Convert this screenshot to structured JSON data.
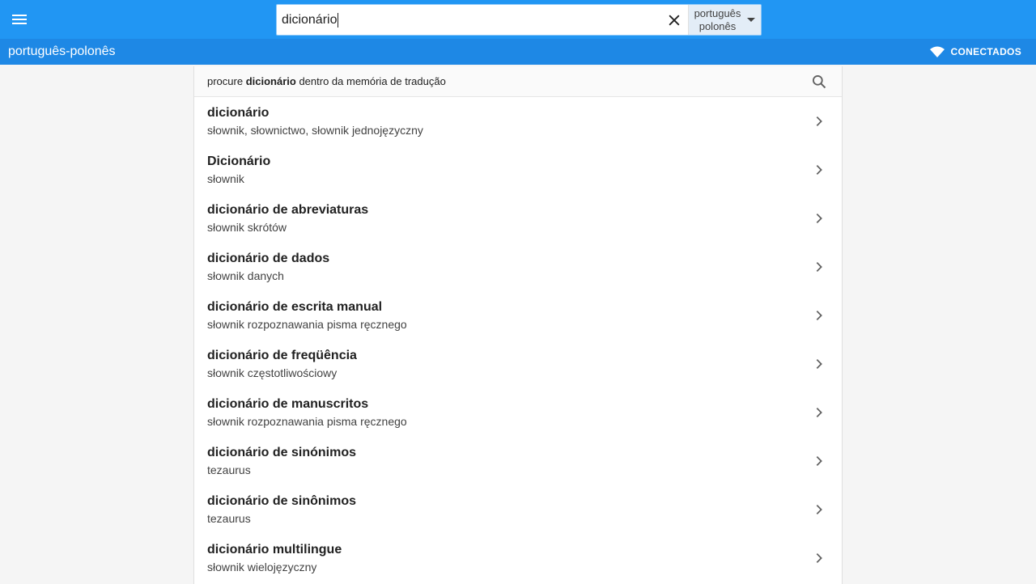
{
  "header": {
    "search_value": "dicionário",
    "lang_from": "português",
    "lang_to": "polonês"
  },
  "subbar": {
    "title": "português-polonês",
    "status": "CONECTADOS"
  },
  "tm_search": {
    "prefix": "procure ",
    "term": "dicionário",
    "suffix": " dentro da memória de tradução"
  },
  "results": [
    {
      "term": "dicionário",
      "translation": "słownik, słownictwo, słownik jednojęzyczny"
    },
    {
      "term": "Dicionário",
      "translation": "słownik"
    },
    {
      "term": "dicionário de abreviaturas",
      "translation": "słownik skrótów"
    },
    {
      "term": "dicionário de dados",
      "translation": "słownik danych"
    },
    {
      "term": "dicionário de escrita manual",
      "translation": "słownik rozpoznawania pisma ręcznego"
    },
    {
      "term": "dicionário de freqüência",
      "translation": "słownik częstotliwościowy"
    },
    {
      "term": "dicionário de manuscritos",
      "translation": "słownik rozpoznawania pisma ręcznego"
    },
    {
      "term": "dicionário de sinónimos",
      "translation": "tezaurus"
    },
    {
      "term": "dicionário de sinônimos",
      "translation": "tezaurus"
    },
    {
      "term": "dicionário multilingue",
      "translation": "słownik wielojęzyczny"
    }
  ],
  "icons": {
    "menu": "menu-icon",
    "clear": "close-icon",
    "dropdown": "dropdown-arrow-icon",
    "wifi": "wifi-icon",
    "search": "search-icon",
    "chevron": "chevron-right-icon"
  },
  "colors": {
    "topbar": "#2196f3",
    "subbar": "#1e88e5"
  }
}
